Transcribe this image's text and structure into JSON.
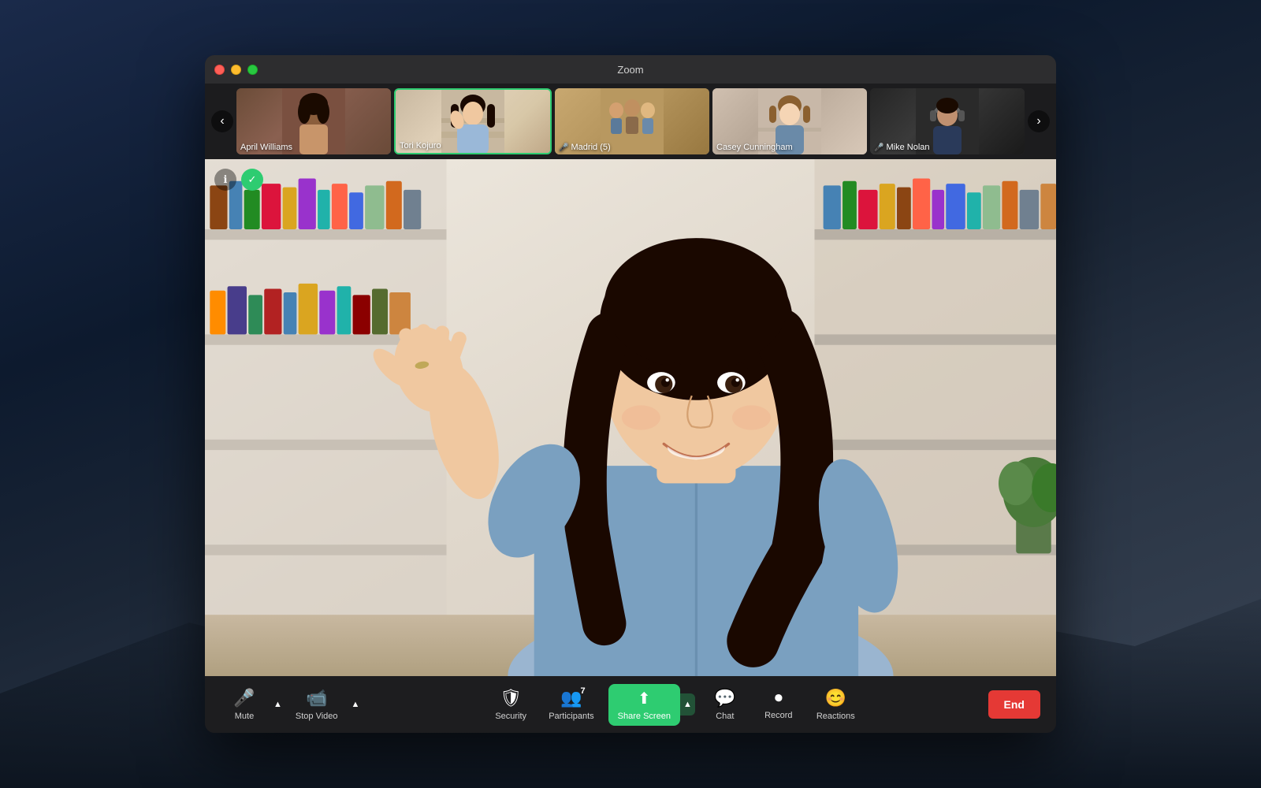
{
  "window": {
    "title": "Zoom"
  },
  "trafficLights": {
    "close": "close",
    "minimize": "minimize",
    "maximize": "maximize"
  },
  "thumbnails": [
    {
      "id": "april-williams",
      "name": "April Williams",
      "active": false,
      "hasMicOff": false,
      "bgColor1": "#7a5c4a",
      "bgColor2": "#9a7a6a"
    },
    {
      "id": "tori-kojuro",
      "name": "Tori Kojuro",
      "active": true,
      "hasMicOff": false,
      "bgColor1": "#c8b8a8",
      "bgColor2": "#a89888"
    },
    {
      "id": "madrid",
      "name": "Madrid (5)",
      "active": false,
      "hasMicOff": true,
      "bgColor1": "#c8a878",
      "bgColor2": "#a88858"
    },
    {
      "id": "casey-cunningham",
      "name": "Casey Cunningham",
      "active": false,
      "hasMicOff": false,
      "bgColor1": "#d8c8b8",
      "bgColor2": "#b8a898"
    },
    {
      "id": "mike-nolan",
      "name": "Mike Nolan",
      "active": false,
      "hasMicOff": true,
      "bgColor1": "#2a2a2a",
      "bgColor2": "#4a4a4a"
    }
  ],
  "mainSpeaker": {
    "name": "Tori Kojuro"
  },
  "controls": {
    "infoButton": "ℹ",
    "shieldButton": "✓",
    "prevLabel": "‹",
    "nextLabel": "›"
  },
  "toolbar": {
    "mute": {
      "icon": "🎤",
      "label": "Mute"
    },
    "stopVideo": {
      "icon": "📹",
      "label": "Stop Video"
    },
    "security": {
      "icon": "🛡",
      "label": "Security"
    },
    "participants": {
      "icon": "👥",
      "label": "Participants",
      "count": "7"
    },
    "shareScreen": {
      "label": "Share Screen"
    },
    "chat": {
      "label": "Chat"
    },
    "record": {
      "label": "Record"
    },
    "reactions": {
      "label": "Reactions"
    },
    "end": {
      "label": "End"
    }
  }
}
